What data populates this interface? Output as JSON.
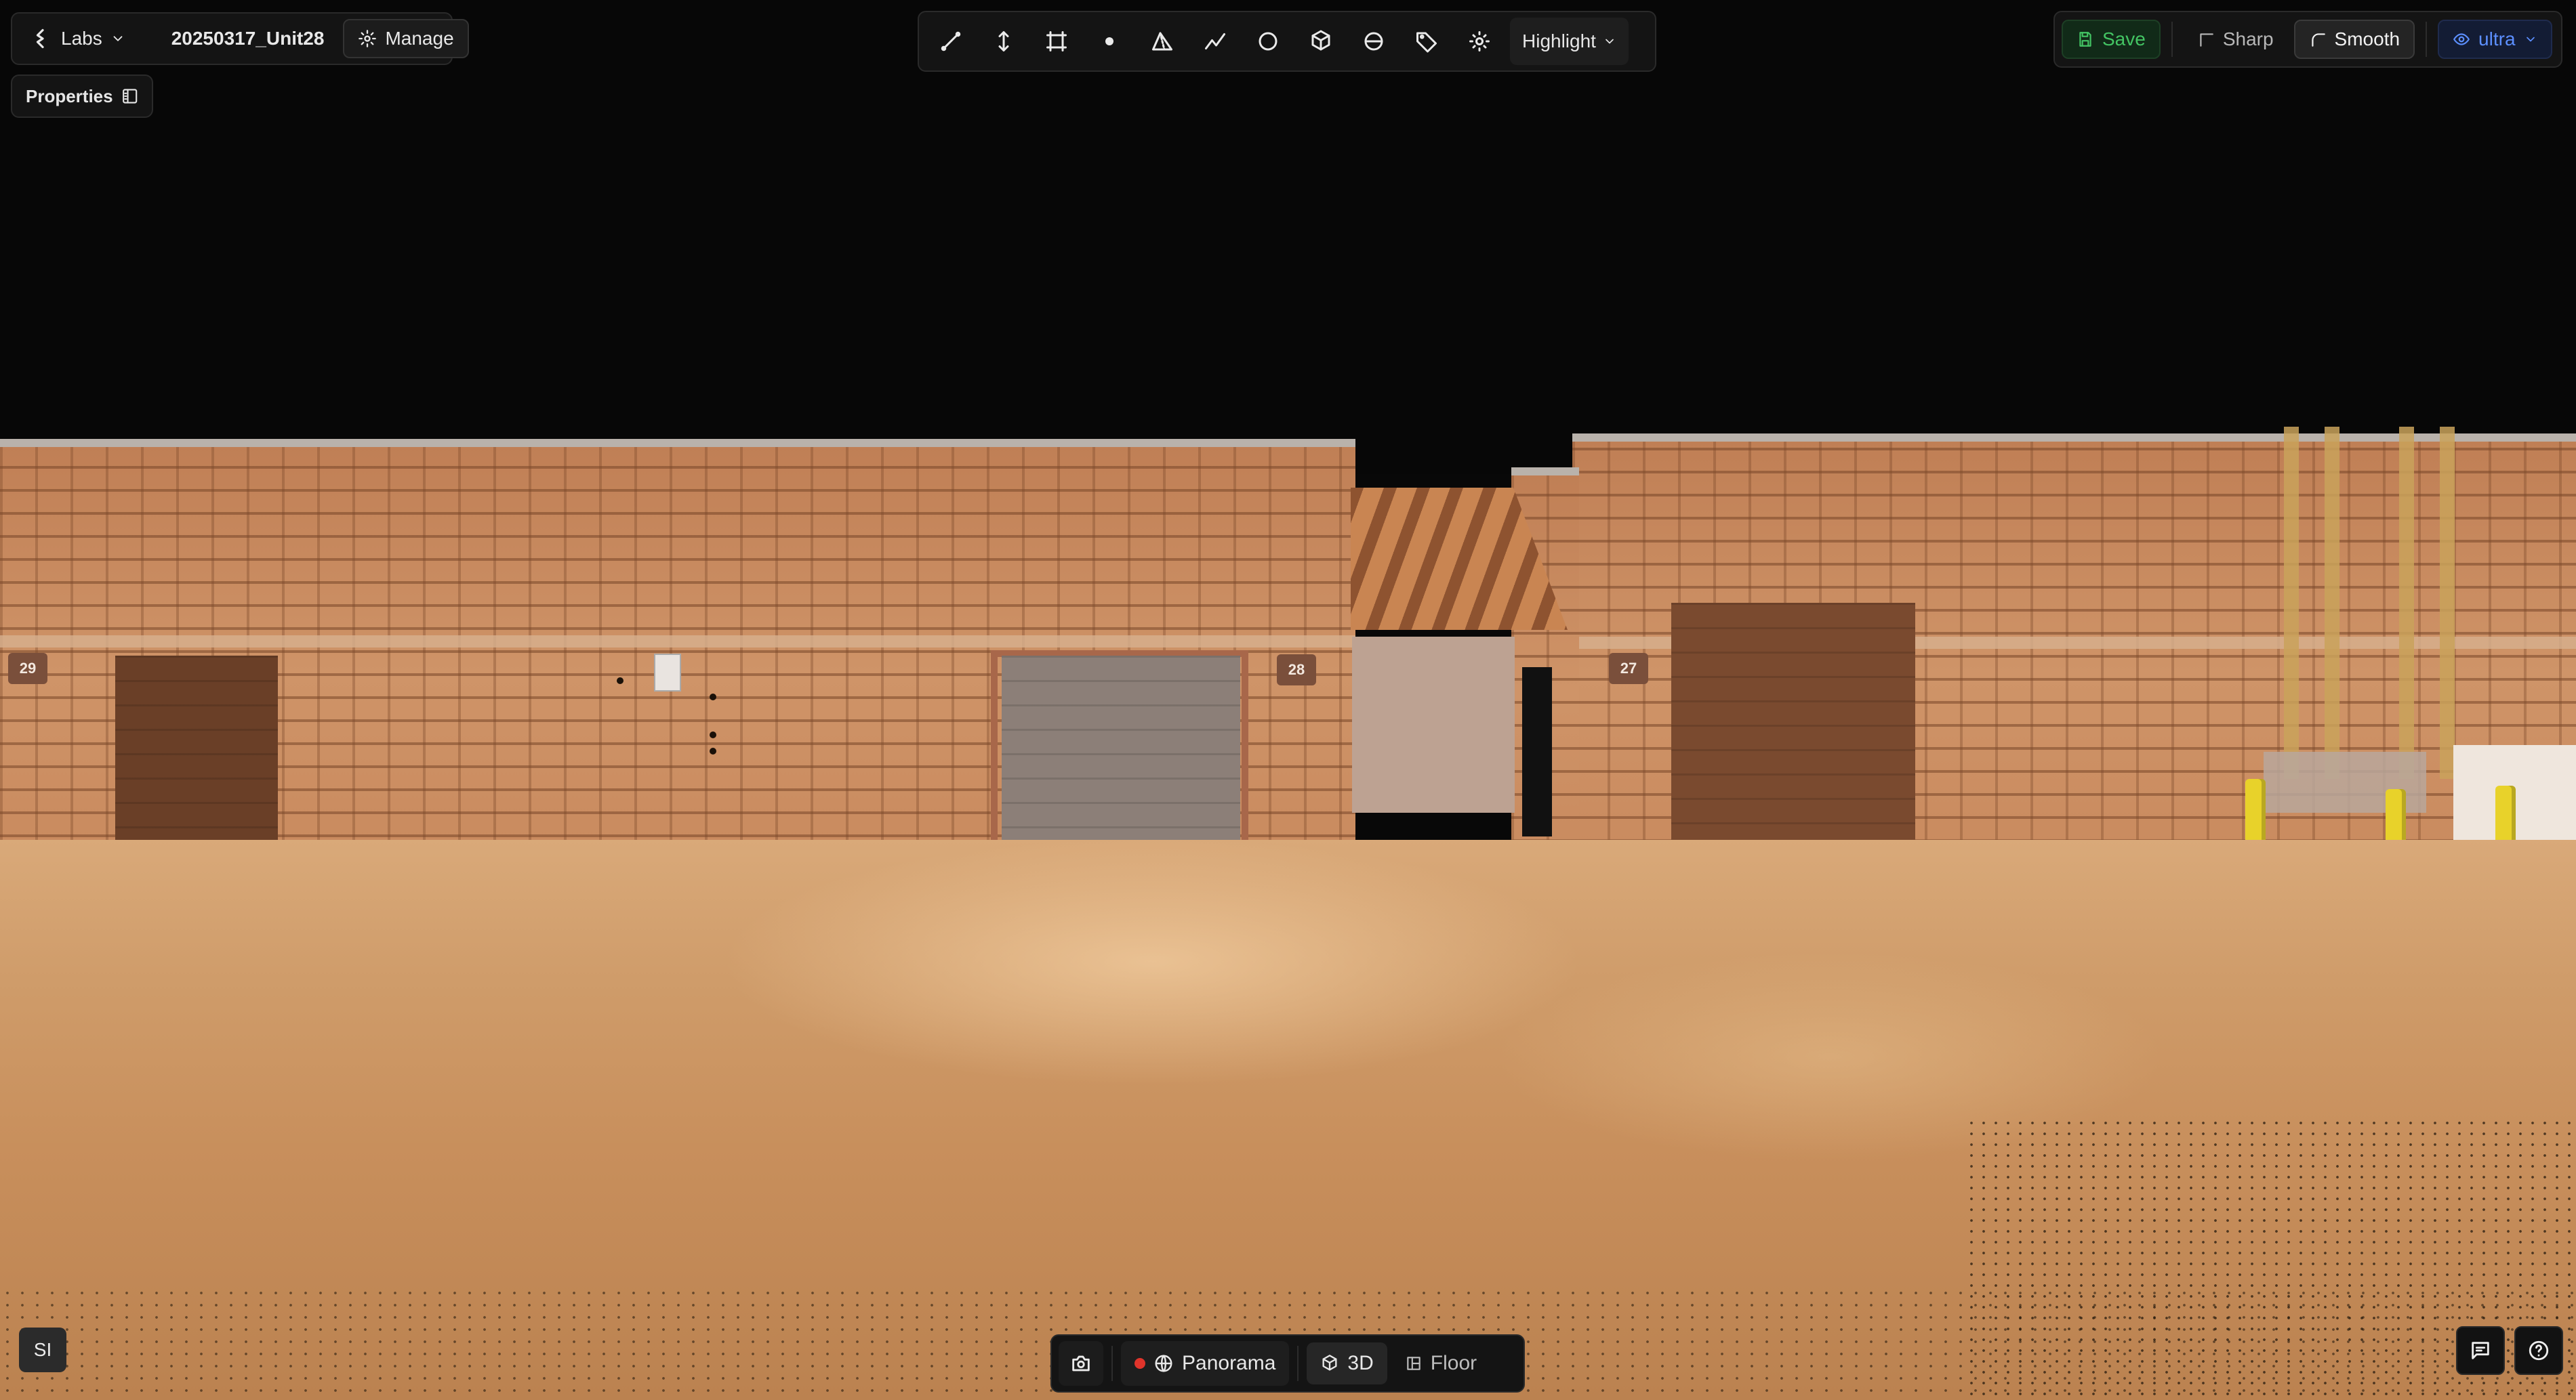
{
  "header": {
    "workspace_label": "Labs",
    "project_name": "20250317_Unit28",
    "manage_label": "Manage",
    "properties_label": "Properties"
  },
  "toolbar": {
    "tools": [
      {
        "name": "line-tool",
        "icon": "line-icon"
      },
      {
        "name": "height-tool",
        "icon": "vertical-arrows-icon"
      },
      {
        "name": "rectangle-tool",
        "icon": "crop-rectangle-icon"
      },
      {
        "name": "point-tool",
        "icon": "dot-icon"
      },
      {
        "name": "triangle-tool",
        "icon": "triangle-icon"
      },
      {
        "name": "polyline-tool",
        "icon": "polyline-icon"
      },
      {
        "name": "circle-tool",
        "icon": "circle-icon"
      },
      {
        "name": "box-tool",
        "icon": "cube-icon"
      },
      {
        "name": "sphere-tool",
        "icon": "sphere-icon"
      },
      {
        "name": "tag-tool",
        "icon": "tag-icon"
      },
      {
        "name": "focus-tool",
        "icon": "focus-icon"
      }
    ],
    "highlight_label": "Highlight"
  },
  "actions": {
    "save_label": "Save",
    "sharp_label": "Sharp",
    "smooth_label": "Smooth",
    "quality_label": "ultra"
  },
  "scene": {
    "unit_numbers": [
      "29",
      "28",
      "27"
    ]
  },
  "bottom_bar": {
    "panorama_label": "Panorama",
    "three_d_label": "3D",
    "floor_label": "Floor"
  },
  "user": {
    "initials": "SI"
  },
  "colors": {
    "save_green": "#43c463",
    "ultra_blue": "#5c8fff",
    "record_red": "#e0342b",
    "background": "#080808"
  }
}
